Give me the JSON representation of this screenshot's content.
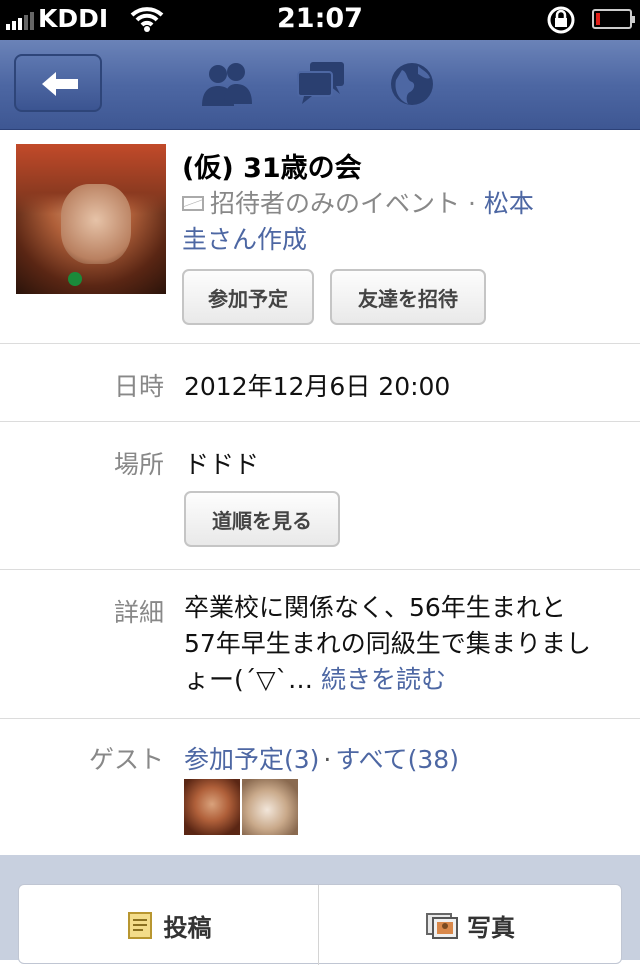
{
  "status_bar": {
    "carrier": "KDDI",
    "time": "21:07",
    "battery_level": 0.12
  },
  "navbar": {
    "icons": [
      "back-arrow-icon",
      "friends-icon",
      "messages-icon",
      "globe-icon"
    ]
  },
  "event": {
    "title": "(仮) 31歳の会",
    "privacy": "招待者のみのイベント",
    "separator": "·",
    "author_line1": "松本",
    "author_line2": "圭さん作成",
    "buttons": {
      "going": "参加予定",
      "invite": "友達を招待"
    }
  },
  "rows": {
    "datetime": {
      "label": "日時",
      "value": "2012年12月6日 20:00"
    },
    "place": {
      "label": "場所",
      "value": "ドドド",
      "directions": "道順を見る"
    },
    "details": {
      "label": "詳細",
      "line1": "卒業校に関係なく、56年生まれと",
      "line2": "57年早生まれの同級生で集まりまし",
      "line3": "ょー(´▽`…",
      "more": "続きを読む"
    },
    "guests": {
      "label": "ゲスト",
      "going": "参加予定(3)",
      "separator": "·",
      "all": "すべて(38)"
    }
  },
  "actions": {
    "post": "投稿",
    "photo": "写真"
  },
  "colors": {
    "navbar": "#4d67a3",
    "link": "#4d67a3",
    "battery_low": "#e0201a"
  }
}
